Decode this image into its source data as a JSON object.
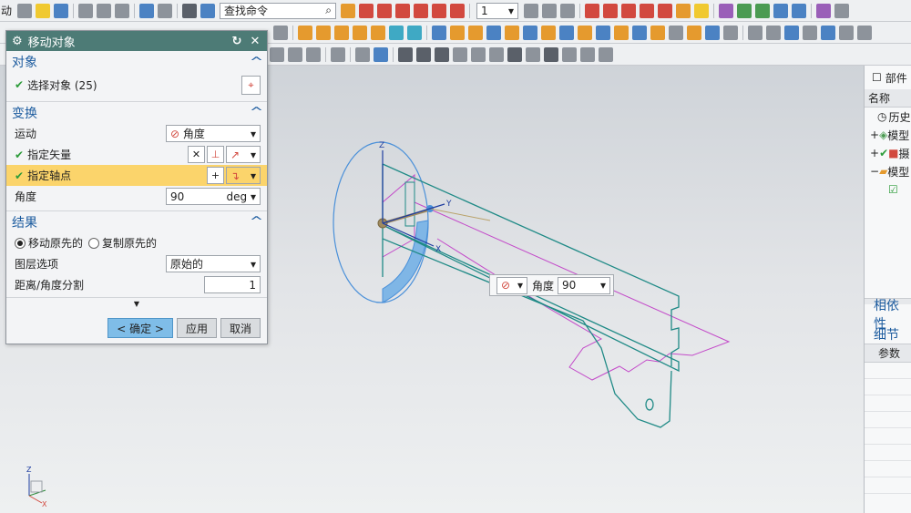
{
  "toolbar": {
    "menu_edge": "动",
    "search_placeholder": "查找命令",
    "layer_combo": "1"
  },
  "dialog": {
    "title": "移动对象",
    "sections": {
      "object": {
        "header": "对象",
        "select_label": "选择对象 (25)"
      },
      "transform": {
        "header": "变换",
        "motion_label": "运动",
        "motion_value": "角度",
        "vector_label": "指定矢量",
        "pivot_label": "指定轴点",
        "angle_label": "角度",
        "angle_value": "90",
        "angle_unit": "deg"
      },
      "result": {
        "header": "结果",
        "move_label": "移动原先的",
        "copy_label": "复制原先的",
        "layer_label": "图层选项",
        "layer_value": "原始的",
        "split_label": "距离/角度分割",
        "split_value": "1"
      }
    },
    "buttons": {
      "ok": "< 确定 >",
      "apply": "应用",
      "cancel": "取消"
    }
  },
  "floater": {
    "label": "角度",
    "value": "90"
  },
  "axes": {
    "z": "Z",
    "y": "Y",
    "x": "X"
  },
  "right_panel": {
    "title": "部件",
    "col_name": "名称",
    "tree": [
      "历史",
      "模型",
      "摄",
      "模型"
    ],
    "dep_header": "相依性",
    "detail_header": "细节",
    "param_col": "参数"
  },
  "colors": {
    "title_bar": "#4d7b76",
    "section_header": "#1d5c9f",
    "highlight_row": "#fbd46b",
    "part_edge": "#1f8a86",
    "preview_edge": "#c34ac9",
    "handle": "#4a90d9"
  }
}
